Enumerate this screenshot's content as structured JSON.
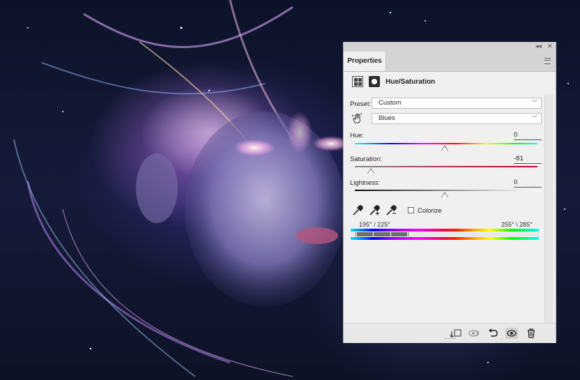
{
  "panel": {
    "tab_label": "Properties",
    "collapse_glyph": "◂◂",
    "close_glyph": "✕",
    "adjustment_title": "Hue/Saturation"
  },
  "preset": {
    "label": "Preset:",
    "value": "Custom"
  },
  "channel": {
    "value": "Blues"
  },
  "sliders": {
    "hue": {
      "label": "Hue:",
      "value": "0",
      "position_fraction": 0.5
    },
    "saturation": {
      "label": "Saturation:",
      "value": "-81",
      "position_fraction": 0.095
    },
    "lightness": {
      "label": "Lightness:",
      "value": "0",
      "position_fraction": 0.5
    }
  },
  "colorize": {
    "label": "Colorize",
    "checked": false
  },
  "range": {
    "left": "195° / 225°",
    "right": "255° \\ 285°"
  },
  "footer_icons": [
    "clip-to-layer-icon",
    "view-previous-icon",
    "reset-icon",
    "visibility-icon",
    "delete-icon"
  ],
  "colors": {
    "panel_bg": "#f0f0f0",
    "titlebar_bg": "#d4d4d4",
    "saturation_track": "#c0102a"
  }
}
